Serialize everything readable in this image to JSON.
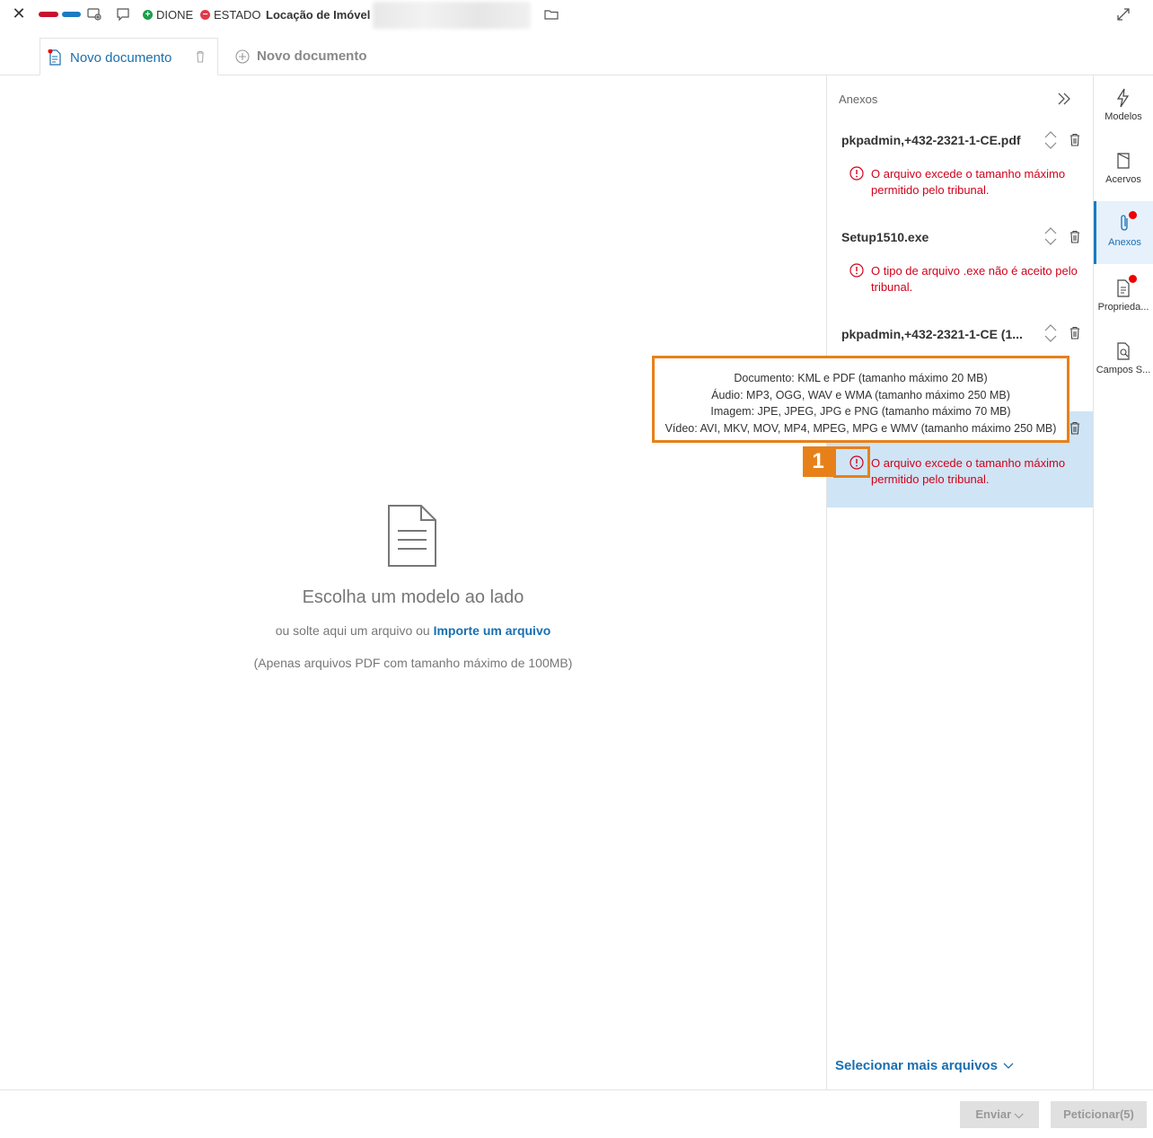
{
  "header": {
    "status_party1": "DIONE",
    "status_party2": "ESTADO",
    "case_title": "Locação de Imóvel"
  },
  "tabs": {
    "active_label": "Novo documento",
    "new_label": "Novo documento"
  },
  "empty_state": {
    "title": "Escolha um modelo ao lado",
    "sub_prefix": "ou solte aqui um arquivo ou ",
    "sub_link": "Importe um arquivo",
    "note": "(Apenas arquivos PDF com tamanho máximo de 100MB)"
  },
  "panel": {
    "title": "Anexos",
    "attachments": [
      {
        "name": "pkpadmin,+432-2321-1-CE.pdf",
        "error": "O arquivo excede o tamanho máximo permitido pelo tribunal."
      },
      {
        "name": "Setup1510.exe",
        "error": "O tipo de arquivo .exe não é aceito pelo tribunal."
      },
      {
        "name": "pkpadmin,+432-2321-1-CE (1...",
        "error": ""
      },
      {
        "name": "",
        "error": "O arquivo excede o tamanho máximo permitido pelo tribunal."
      }
    ],
    "more_files": "Selecionar mais arquivos"
  },
  "tooltip": {
    "line1": "Documento: KML e PDF (tamanho máximo 20 MB)",
    "line2": "Áudio: MP3, OGG, WAV e WMA (tamanho máximo 250 MB)",
    "line3": "Imagem: JPE, JPEG, JPG e PNG (tamanho máximo 70 MB)",
    "line4": "Vídeo: AVI, MKV, MOV, MP4, MPEG, MPG e WMV (tamanho máximo 250 MB)"
  },
  "callout": {
    "number": "1"
  },
  "rail": {
    "items": [
      {
        "label": "Modelos",
        "icon": "lightning-icon"
      },
      {
        "label": "Acervos",
        "icon": "archive-icon"
      },
      {
        "label": "Anexos",
        "icon": "paperclip-icon"
      },
      {
        "label": "Proprieda...",
        "icon": "document-properties-icon"
      },
      {
        "label": "Campos S...",
        "icon": "document-search-icon"
      }
    ]
  },
  "footer": {
    "send_label": "Enviar",
    "petition_label": "Peticionar(5)"
  },
  "colors": {
    "accent": "#1a6fb0",
    "error": "#d0021b",
    "callout": "#e8801a",
    "highlight": "#cfe4f5"
  }
}
